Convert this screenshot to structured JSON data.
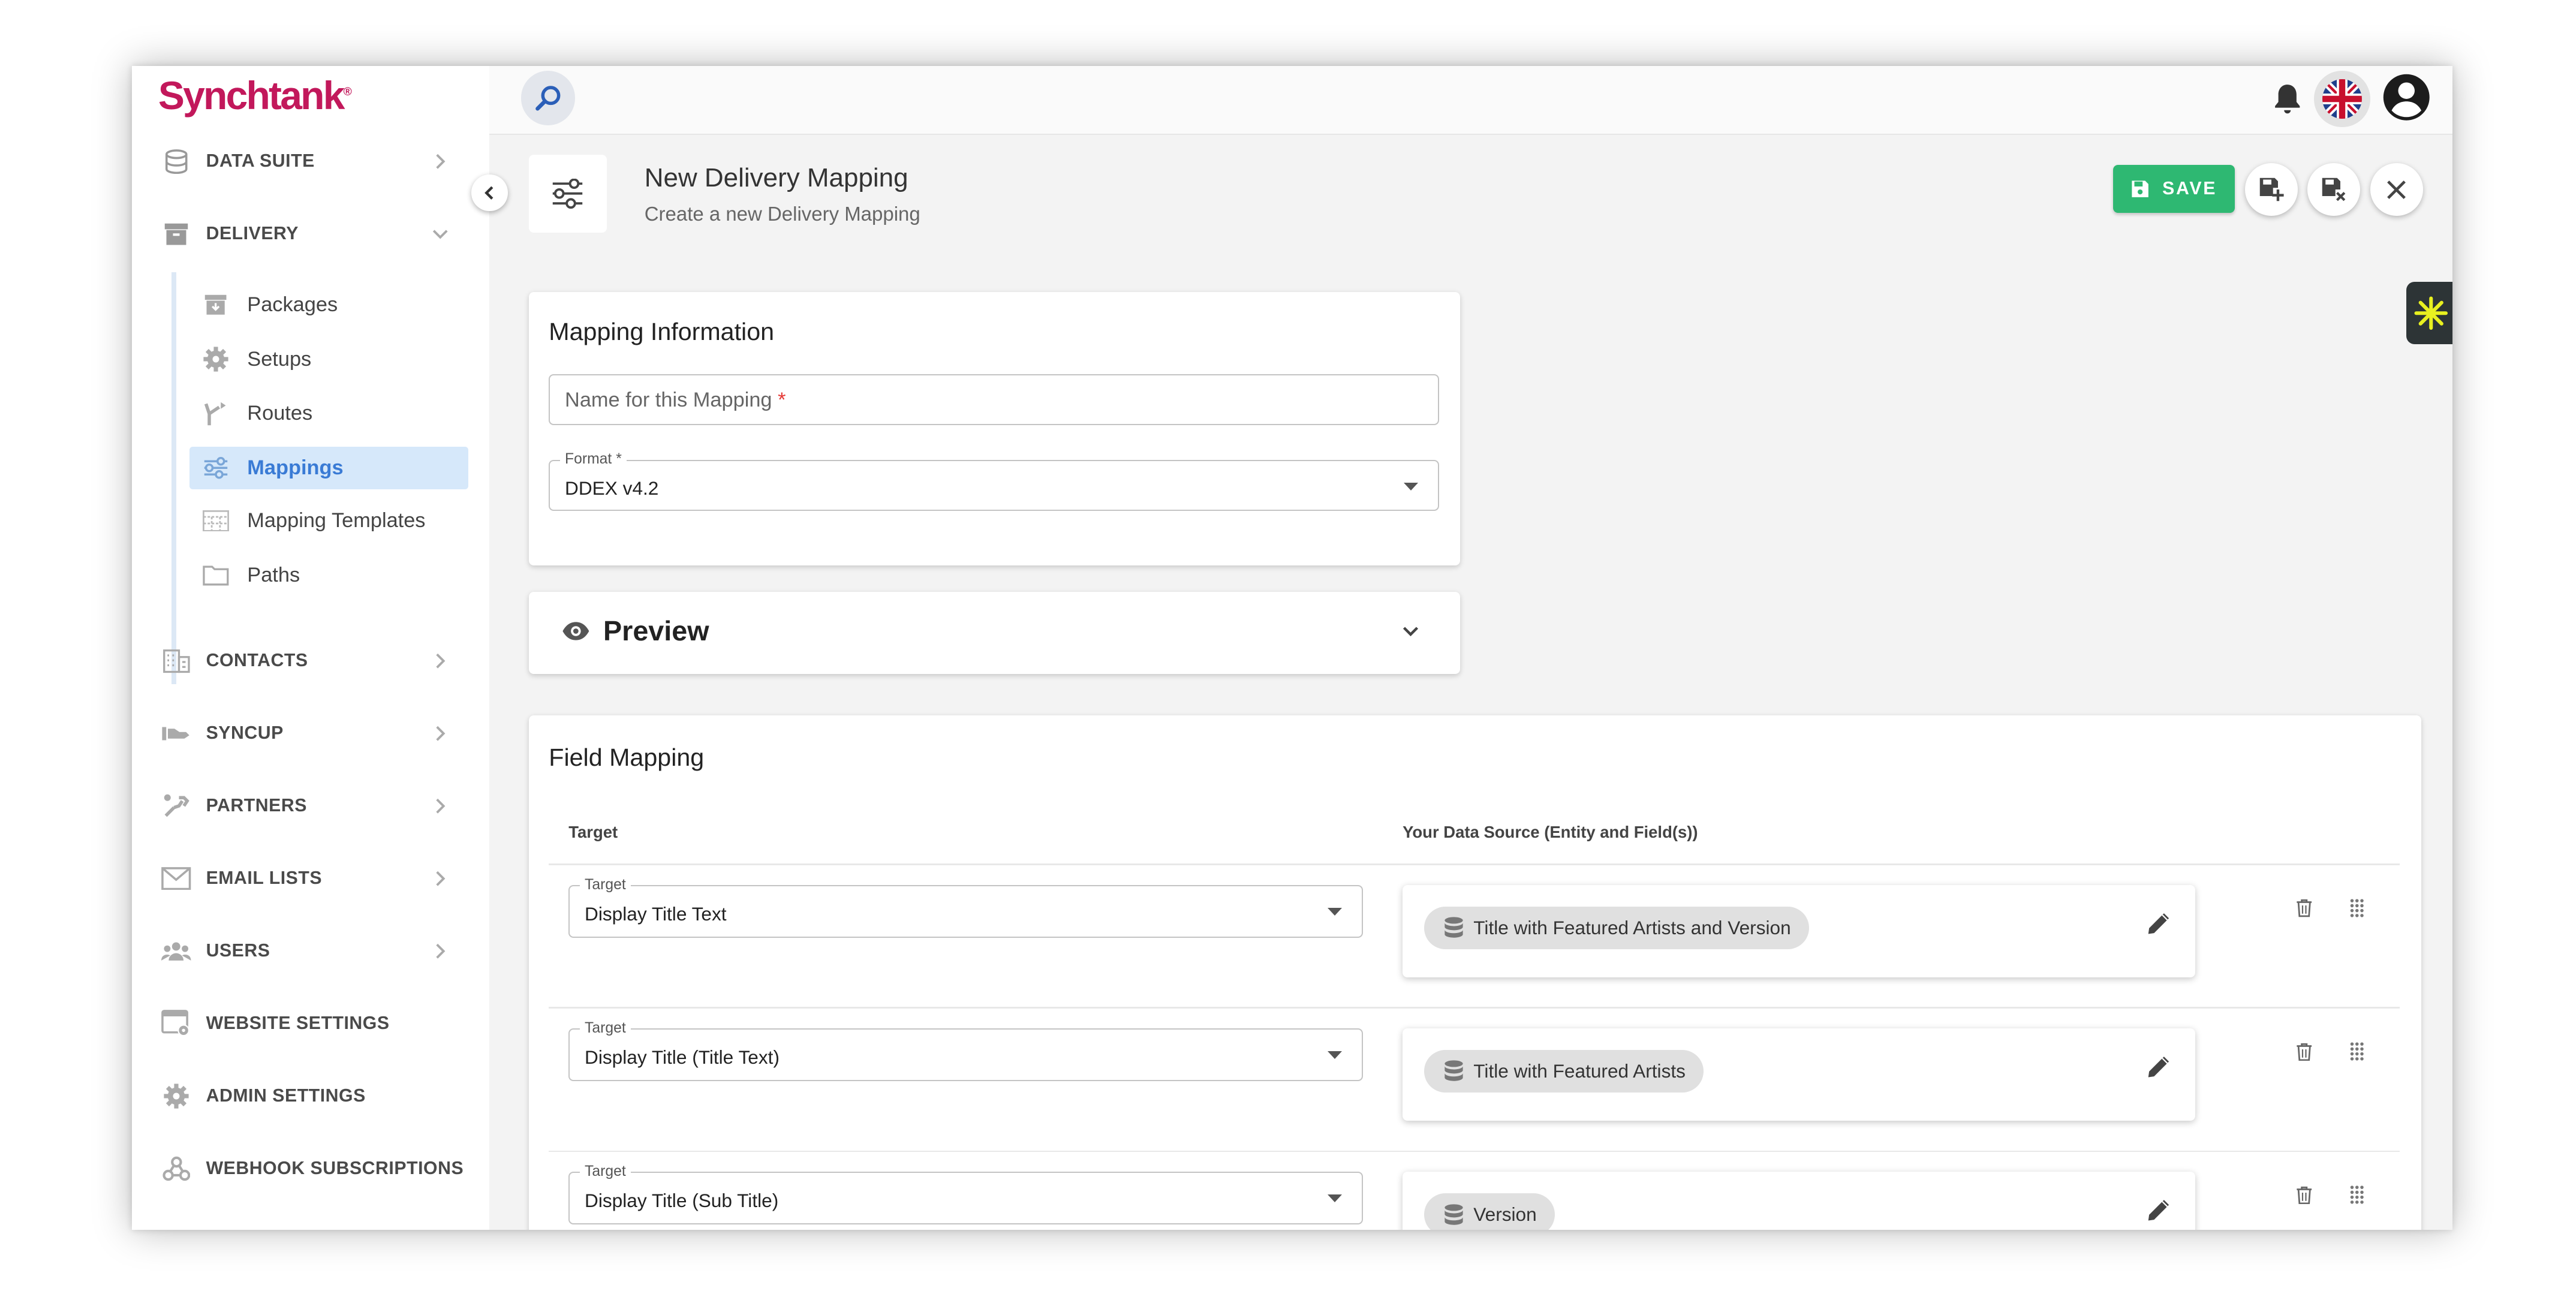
{
  "app": {
    "logo_text": "Synchtank",
    "logo_mark": "®"
  },
  "sidebar": {
    "sections": [
      {
        "label": "DATA SUITE",
        "icon": "database-icon"
      },
      {
        "label": "DELIVERY",
        "icon": "archive-box-icon",
        "expanded": true
      },
      {
        "label": "CONTACTS",
        "icon": "building-icon"
      },
      {
        "label": "SYNCUP",
        "icon": "handshake-icon"
      },
      {
        "label": "PARTNERS",
        "icon": "partners-icon"
      },
      {
        "label": "EMAIL LISTS",
        "icon": "envelope-icon"
      },
      {
        "label": "USERS",
        "icon": "users-icon"
      },
      {
        "label": "WEBSITE SETTINGS",
        "icon": "website-settings-icon"
      },
      {
        "label": "ADMIN SETTINGS",
        "icon": "gear-icon"
      },
      {
        "label": "WEBHOOK SUBSCRIPTIONS",
        "icon": "webhook-icon"
      }
    ],
    "delivery_items": [
      {
        "label": "Packages",
        "icon": "archive-box-icon"
      },
      {
        "label": "Setups",
        "icon": "gear-icon"
      },
      {
        "label": "Routes",
        "icon": "route-fork-icon"
      },
      {
        "label": "Mappings",
        "icon": "mapping-icon",
        "active": true
      },
      {
        "label": "Mapping Templates",
        "icon": "table-grid-icon"
      },
      {
        "label": "Paths",
        "icon": "folder-icon"
      }
    ]
  },
  "header": {
    "title": "New Delivery Mapping",
    "subtitle": "Create a new Delivery Mapping",
    "save_label": "SAVE"
  },
  "mapping_info": {
    "title": "Mapping Information",
    "name_placeholder": "Name for this Mapping",
    "required_mark": "*",
    "format_label": "Format",
    "format_value": "DDEX v4.2"
  },
  "preview": {
    "title": "Preview"
  },
  "field_mapping": {
    "title": "Field Mapping",
    "col_target": "Target",
    "col_source": "Your Data Source (Entity and Field(s))",
    "rows": [
      {
        "target_label": "Target",
        "target_value": "Display Title Text",
        "source": "Title with Featured Artists and Version"
      },
      {
        "target_label": "Target",
        "target_value": "Display Title (Title Text)",
        "source": "Title with Featured Artists"
      },
      {
        "target_label": "Target",
        "target_value": "Display Title (Sub Title)",
        "source": "Version"
      }
    ]
  },
  "colors": {
    "brand": "#c2185b",
    "save": "#2eb872",
    "active_bg": "#d6e8fa",
    "active_text": "#3a7bd5"
  }
}
